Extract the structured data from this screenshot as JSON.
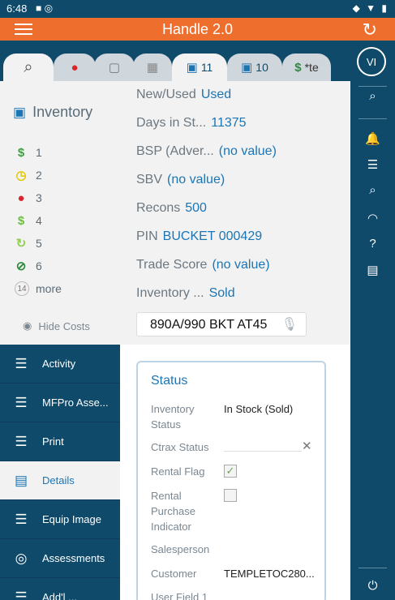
{
  "status_bar": {
    "time": "6:48",
    "left_icons": "■ ◎",
    "right_icons": "◆ ▼ ▮"
  },
  "app_bar": {
    "title": "Handle 2.0"
  },
  "tabs": [
    {
      "icon": "search-icon",
      "glyph": "⌕",
      "label": "",
      "active": true
    },
    {
      "icon": "location-pin-icon",
      "glyph": "●",
      "label": "",
      "color": "#d9262c"
    },
    {
      "icon": "chat-icon",
      "glyph": "▢",
      "label": ""
    },
    {
      "icon": "calendar-icon",
      "glyph": "▦",
      "label": ""
    },
    {
      "icon": "cart-icon",
      "glyph": "🛒",
      "label": "11",
      "active": true
    },
    {
      "icon": "cart-icon",
      "glyph": "🛒",
      "label": "10"
    },
    {
      "icon": "dollar-icon",
      "glyph": "$",
      "label": "*te",
      "color": "#2e8b3e"
    }
  ],
  "left": {
    "inventory_label": "Inventory",
    "filters": [
      {
        "icon": "dollar-icon",
        "glyph": "$",
        "color": "#3f9e3f",
        "label": "1"
      },
      {
        "icon": "clock-icon",
        "glyph": "◷",
        "color": "#e3c900",
        "label": "2"
      },
      {
        "icon": "user-icon",
        "glyph": "●",
        "color": "#d9262c",
        "label": "3"
      },
      {
        "icon": "dollar-icon",
        "glyph": "$",
        "color": "#6bbf3f",
        "label": "4"
      },
      {
        "icon": "recycle-icon",
        "glyph": "↻",
        "color": "#8fd14f",
        "label": "5"
      },
      {
        "icon": "prohibited-icon",
        "glyph": "⊘",
        "color": "#2e8b3e",
        "label": "6"
      }
    ],
    "more_count": "14",
    "more_label": "more",
    "hide_costs": "Hide Costs"
  },
  "nav": [
    {
      "icon": "menu-icon",
      "glyph": "☰",
      "label": "Activity"
    },
    {
      "icon": "menu-icon",
      "glyph": "☰",
      "label": "MFPro Asse..."
    },
    {
      "icon": "menu-icon",
      "glyph": "☰",
      "label": "Print"
    },
    {
      "icon": "document-icon",
      "glyph": "▤",
      "label": "Details",
      "active": true
    },
    {
      "icon": "menu-icon",
      "glyph": "☰",
      "label": "Equip Image"
    },
    {
      "icon": "target-icon",
      "glyph": "◎",
      "label": "Assessments"
    },
    {
      "icon": "menu-icon",
      "glyph": "☰",
      "label": "Add'l ..."
    }
  ],
  "fields": [
    {
      "label": "New/Used",
      "value": "Used"
    },
    {
      "label": "Days in St...",
      "value": "11375"
    },
    {
      "label": "BSP (Adver...",
      "value": "(no value)"
    },
    {
      "label": "SBV",
      "value": "(no value)"
    },
    {
      "label": "Recons",
      "value": "500"
    },
    {
      "label": "PIN",
      "value": "BUCKET 000429"
    },
    {
      "label": "Trade Score",
      "value": "(no value)"
    },
    {
      "label": "Inventory ...",
      "value": "Sold"
    }
  ],
  "search_value": "890A/990 BKT AT45",
  "status_card": {
    "title": "Status",
    "rows": [
      {
        "label": "Inventory Status",
        "value": "In Stock (Sold)"
      },
      {
        "label": "Ctrax Status",
        "value": ""
      },
      {
        "label": "Rental Flag",
        "value": "",
        "checked": true
      },
      {
        "label": "Rental Purchase Indicator",
        "value": "",
        "checked": false
      },
      {
        "label": "Salesperson",
        "value": ""
      },
      {
        "label": "Customer",
        "value": "TEMPLETOC280..."
      },
      {
        "label": "User Field 1",
        "value": ""
      }
    ]
  },
  "rail": {
    "avatar": "VI",
    "buttons": [
      {
        "icon": "search-icon",
        "glyph": "⌕"
      },
      {
        "icon": "bell-icon",
        "glyph": "🔔"
      },
      {
        "icon": "menu-icon",
        "glyph": "☰"
      },
      {
        "icon": "search-icon",
        "glyph": "⌕"
      },
      {
        "icon": "gauge-icon",
        "glyph": "◠"
      },
      {
        "icon": "help-icon",
        "glyph": "?"
      },
      {
        "icon": "table-icon",
        "glyph": "▤"
      },
      {
        "icon": "power-icon",
        "glyph": "⏻"
      }
    ]
  }
}
